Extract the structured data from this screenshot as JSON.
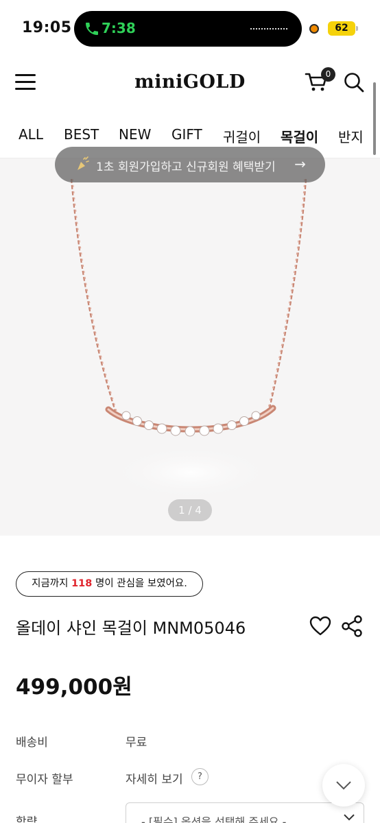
{
  "status_bar": {
    "time": "19:05",
    "call_timer": "7:38",
    "battery_level": "62",
    "icons": [
      "phone-icon",
      "audio-wave-icon",
      "recording-indicator",
      "battery-icon"
    ]
  },
  "header": {
    "logo": "miniGOLD",
    "cart_count": "0",
    "icons": [
      "hamburger-menu-icon",
      "cart-icon",
      "search-icon"
    ]
  },
  "categories": [
    "ALL",
    "BEST",
    "NEW",
    "GIFT",
    "귀걸이",
    "목걸이",
    "반지"
  ],
  "active_category": "목걸이",
  "promo": {
    "text": "1초 회원가입하고 신규회원 혜택받기",
    "arrow": "→"
  },
  "gallery": {
    "counter": "1 / 4"
  },
  "interest": {
    "prefix": "지금까지",
    "count": "118",
    "suffix": "명이 관심을 보였어요."
  },
  "product": {
    "title": "올데이 샤인 목걸이 MNM05046",
    "price": "499,000원"
  },
  "info_rows": {
    "shipping_label": "배송비",
    "shipping_value": "무료",
    "installment_label": "무이자 할부",
    "installment_value": "자세히 보기",
    "help_mark": "?",
    "option_label": "함량",
    "option_placeholder": "- [필수] 옵션을 선택해 주세요 -"
  },
  "colors": {
    "accent_red": "#e0242d",
    "call_green": "#2fd158",
    "battery_yellow": "#f5d20b",
    "chain_rose_gold": "#c98673"
  }
}
